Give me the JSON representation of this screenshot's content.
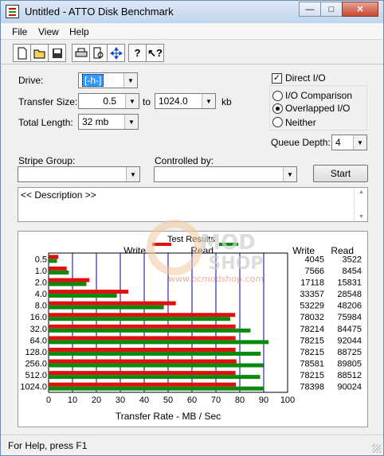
{
  "window": {
    "title": "Untitled - ATTO Disk Benchmark"
  },
  "menu": [
    "File",
    "View",
    "Help"
  ],
  "toolbar": {
    "icons": [
      "new-file-icon",
      "open-folder-icon",
      "save-icon",
      "print-icon",
      "print-preview-icon",
      "move-icon",
      "help-icon",
      "context-help-icon"
    ]
  },
  "form": {
    "drive_label": "Drive:",
    "drive_value": "[-h-]",
    "transfer_size_label": "Transfer Size:",
    "transfer_from": "0.5",
    "to_label": "to",
    "transfer_to": "1024.0",
    "kb_label": "kb",
    "total_length_label": "Total Length:",
    "total_length_value": "32 mb",
    "direct_io_label": "Direct I/O",
    "direct_io_checked": true,
    "io_comparison_label": "I/O Comparison",
    "overlapped_io_label": "Overlapped I/O",
    "neither_label": "Neither",
    "selected_mode": "Overlapped I/O",
    "queue_depth_label": "Queue Depth:",
    "queue_depth_value": "4",
    "stripe_group_label": "Stripe Group:",
    "stripe_group_value": "",
    "controlled_by_label": "Controlled by:",
    "controlled_by_value": "",
    "start_button": "Start",
    "description_text": "<< Description >>"
  },
  "watermark": {
    "line1": "MOD",
    "line2": "SHOP",
    "url": "www.ocmodshop.com"
  },
  "chart_data": {
    "type": "bar",
    "title": "Test Results",
    "xlabel": "Transfer Rate - MB / Sec",
    "xlim": [
      0,
      100
    ],
    "xticks": [
      "0",
      "10",
      "20",
      "30",
      "40",
      "50",
      "60",
      "70",
      "80",
      "90",
      "100"
    ],
    "categories": [
      "0.5",
      "1.0",
      "2.0",
      "4.0",
      "8.0",
      "16.0",
      "32.0",
      "64.0",
      "128.0",
      "256.0",
      "512.0",
      "1024.0"
    ],
    "legend": [
      "Write",
      "Read"
    ],
    "column_headers": [
      "Write",
      "Read"
    ],
    "colors": {
      "write": "#e01010",
      "read": "#0a8a0a",
      "grid": "#0000a0"
    },
    "series": [
      {
        "name": "Write",
        "values": [
          4045,
          7566,
          17118,
          33357,
          53229,
          78032,
          78214,
          78215,
          78215,
          78581,
          78215,
          78398
        ]
      },
      {
        "name": "Read",
        "values": [
          3522,
          8454,
          15831,
          28548,
          48206,
          75984,
          84475,
          92044,
          88725,
          89805,
          88512,
          90024
        ]
      }
    ],
    "value_unit_divisor": 1000
  },
  "status": {
    "text": "For Help, press F1"
  }
}
